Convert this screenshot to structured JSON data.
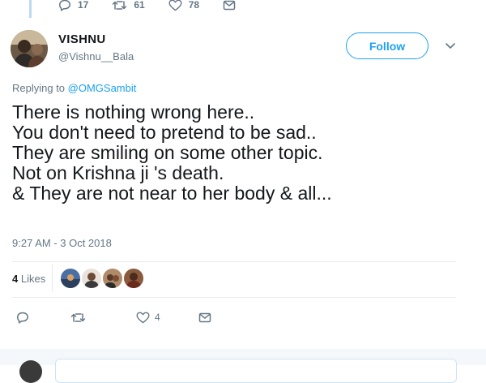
{
  "previous_tweet": {
    "reply_count": "17",
    "retweet_count": "61",
    "like_count": "78"
  },
  "user": {
    "name": "VISHNU",
    "handle": "@Vishnu__Bala"
  },
  "follow_button_label": "Follow",
  "replying_prefix": "Replying to ",
  "replying_to": "@OMGSambit",
  "tweet_lines": [
    "There is nothing wrong here..",
    "You don't need to pretend to be sad..",
    "They are smiling on some other topic.",
    "Not on Krishna ji 's death.",
    "& They are not near to her body & all..."
  ],
  "timestamp": "9:27 AM - 3 Oct 2018",
  "likes": {
    "count": "4",
    "label": "Likes"
  },
  "actions": {
    "like_count": "4"
  },
  "colors": {
    "accent": "#1da1f2",
    "secondary_text": "#657786",
    "divider": "#e6ecf0"
  },
  "icons": [
    "reply-icon",
    "retweet-icon",
    "heart-icon",
    "direct-message-icon",
    "chevron-down-icon"
  ]
}
